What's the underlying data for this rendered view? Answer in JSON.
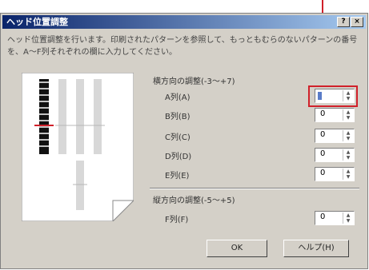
{
  "dialog": {
    "title": "ヘッド位置調整",
    "help_btn": "?",
    "close_btn": "×",
    "description": "ヘッド位置調整を行います。印刷されたパターンを参照して、もっともむらのないパターンの番号を、A～F列それぞれの欄に入力してください。"
  },
  "horizontal_group": {
    "label": "横方向の調整(-3～+7)",
    "rows": [
      {
        "label": "A列(A)",
        "value": "0"
      },
      {
        "label": "B列(B)",
        "value": "0"
      },
      {
        "label": "C列(C)",
        "value": "0"
      },
      {
        "label": "D列(D)",
        "value": "0"
      },
      {
        "label": "E列(E)",
        "value": "0"
      }
    ]
  },
  "vertical_group": {
    "label": "縦方向の調整(-5～+5)",
    "rows": [
      {
        "label": "F列(F)",
        "value": "0"
      }
    ]
  },
  "buttons": {
    "ok": "OK",
    "help": "ヘルプ(H)"
  },
  "colors": {
    "highlight": "#d0202a",
    "title_bar": "#0a246a"
  }
}
